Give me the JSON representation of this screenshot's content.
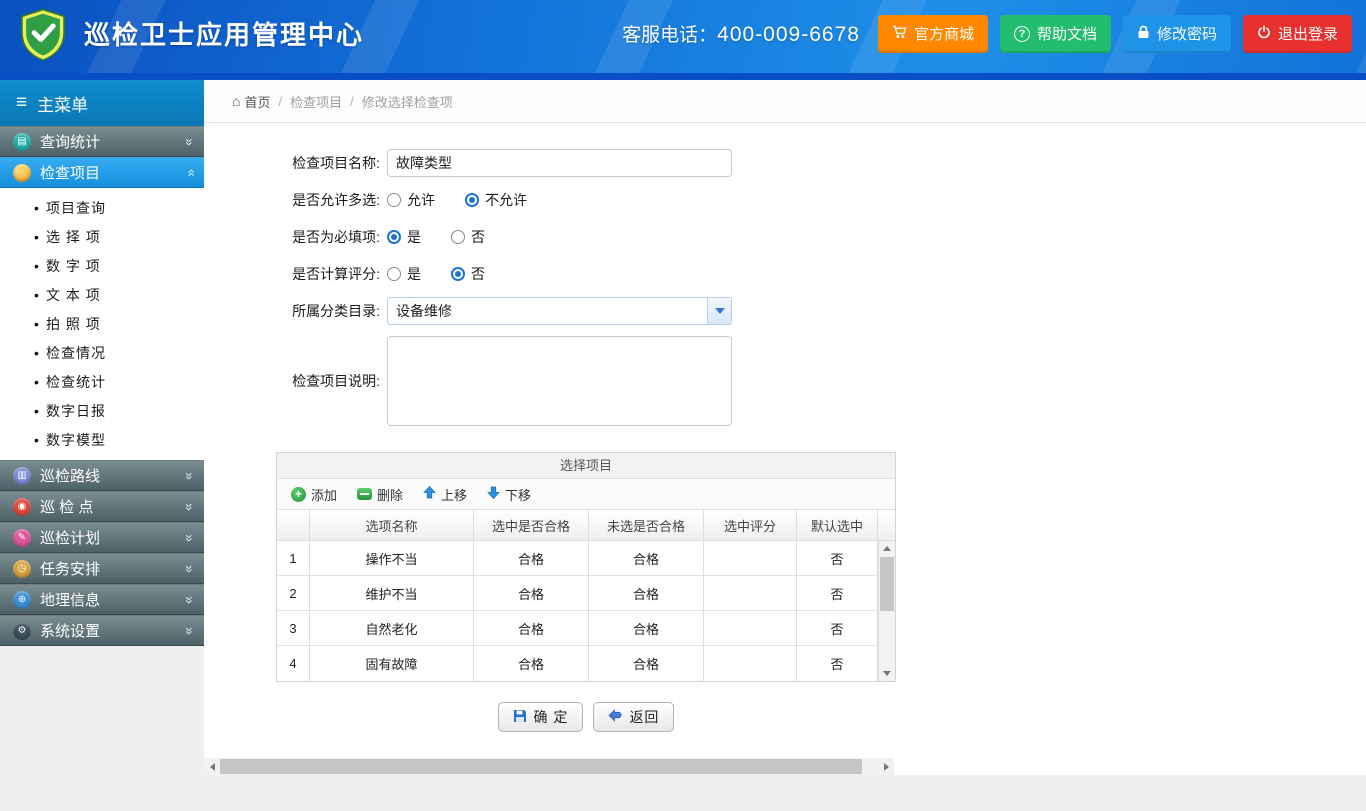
{
  "colors": {
    "header_blue": "#1272d8",
    "active_menu_blue": "#1e9ae6",
    "shop_orange": "#ff8800",
    "help_green": "#23bd6e",
    "password_blue": "#1f93e8",
    "logout_red": "#e8312f"
  },
  "header": {
    "title": "巡检卫士应用管理中心",
    "phone_label": "客服电话：",
    "phone_number": "400-009-6678",
    "buttons": {
      "shop": "官方商城",
      "help": "帮助文档",
      "password": "修改密码",
      "logout": "退出登录"
    }
  },
  "sidebar": {
    "menu_title": "主菜单",
    "items": [
      {
        "label": "查询统计"
      },
      {
        "label": "检查项目",
        "children": [
          {
            "label": "项目查询"
          },
          {
            "label": "选 择 项"
          },
          {
            "label": "数 字 项"
          },
          {
            "label": "文 本 项"
          },
          {
            "label": "拍 照 项"
          },
          {
            "label": "检查情况"
          },
          {
            "label": "检查统计"
          },
          {
            "label": "数字日报"
          },
          {
            "label": "数字模型"
          }
        ]
      },
      {
        "label": "巡检路线"
      },
      {
        "label": "巡 检 点"
      },
      {
        "label": "巡检计划"
      },
      {
        "label": "任务安排"
      },
      {
        "label": "地理信息"
      },
      {
        "label": "系统设置"
      }
    ]
  },
  "breadcrumb": {
    "home": "首页",
    "section": "检查项目",
    "current": "修改选择检查项"
  },
  "form": {
    "name_label": "检查项目名称:",
    "name_value": "故障类型",
    "multi_label": "是否允许多选:",
    "multi_yes": "允许",
    "multi_no": "不允许",
    "multi_selected": "不允许",
    "required_label": "是否为必填项:",
    "required_yes": "是",
    "required_no": "否",
    "required_selected": "是",
    "score_label": "是否计算评分:",
    "score_yes": "是",
    "score_no": "否",
    "score_selected": "否",
    "category_label": "所属分类目录:",
    "category_value": "设备维修",
    "desc_label": "检查项目说明:",
    "desc_value": ""
  },
  "options_table": {
    "title": "选择项目",
    "toolbar": {
      "add": "添加",
      "remove": "删除",
      "up": "上移",
      "down": "下移"
    },
    "columns": {
      "name": "选项名称",
      "selected_ok": "选中是否合格",
      "unselected_ok": "未选是否合格",
      "score": "选中评分",
      "default": "默认选中"
    },
    "rows": [
      {
        "index": "1",
        "name": "操作不当",
        "selected_ok": "合格",
        "unselected_ok": "合格",
        "score": "",
        "default": "否"
      },
      {
        "index": "2",
        "name": "维护不当",
        "selected_ok": "合格",
        "unselected_ok": "合格",
        "score": "",
        "default": "否"
      },
      {
        "index": "3",
        "name": "自然老化",
        "selected_ok": "合格",
        "unselected_ok": "合格",
        "score": "",
        "default": "否"
      },
      {
        "index": "4",
        "name": "固有故障",
        "selected_ok": "合格",
        "unselected_ok": "合格",
        "score": "",
        "default": "否"
      }
    ]
  },
  "actions": {
    "confirm": "确 定",
    "back": "返回"
  }
}
